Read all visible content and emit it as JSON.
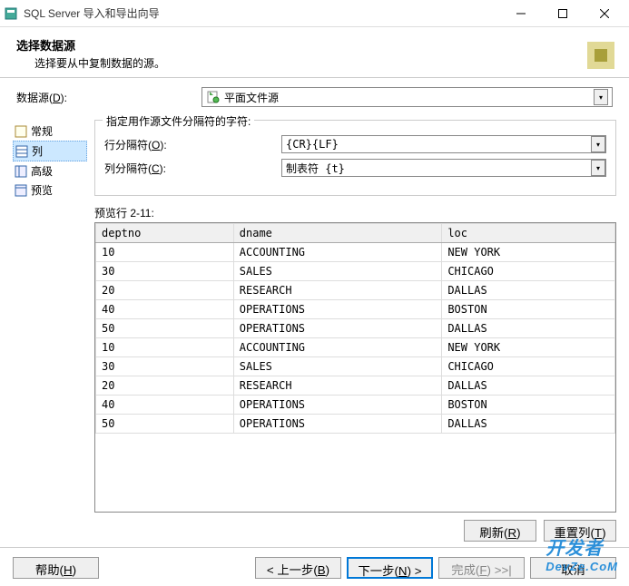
{
  "titlebar": {
    "text": "SQL Server 导入和导出向导"
  },
  "header": {
    "title": "选择数据源",
    "subtitle": "选择要从中复制数据的源。"
  },
  "datasource": {
    "label_pre": "数据源(",
    "label_key": "D",
    "label_post": "):",
    "value": "平面文件源"
  },
  "sidebar": {
    "items": [
      {
        "label": "常规"
      },
      {
        "label": "列"
      },
      {
        "label": "高级"
      },
      {
        "label": "预览"
      }
    ]
  },
  "delimiters": {
    "legend": "指定用作源文件分隔符的字符:",
    "row": {
      "label_pre": "行分隔符(",
      "label_key": "O",
      "label_post": "):",
      "value": "{CR}{LF}"
    },
    "col": {
      "label_pre": "列分隔符(",
      "label_key": "C",
      "label_post": "):",
      "value": "制表符 {t}"
    }
  },
  "preview": {
    "label": "预览行 2-11:",
    "columns": [
      "deptno",
      "dname",
      "loc"
    ],
    "rows": [
      [
        "10",
        "ACCOUNTING",
        "NEW YORK"
      ],
      [
        "30",
        "SALES",
        "CHICAGO"
      ],
      [
        "20",
        "RESEARCH",
        "DALLAS"
      ],
      [
        "40",
        "OPERATIONS",
        "BOSTON"
      ],
      [
        "50",
        "OPERATIONS",
        "DALLAS"
      ],
      [
        "10",
        "ACCOUNTING",
        "NEW YORK"
      ],
      [
        "30",
        "SALES",
        "CHICAGO"
      ],
      [
        "20",
        "RESEARCH",
        "DALLAS"
      ],
      [
        "40",
        "OPERATIONS",
        "BOSTON"
      ],
      [
        "50",
        "OPERATIONS",
        "DALLAS"
      ]
    ]
  },
  "buttons": {
    "refresh_pre": "刷新(",
    "refresh_key": "R",
    "refresh_post": ")",
    "reset_pre": "重置列(",
    "reset_key": "T",
    "reset_post": ")",
    "help_pre": "帮助(",
    "help_key": "H",
    "help_post": ")",
    "back_pre": "< 上一步(",
    "back_key": "B",
    "back_post": ")",
    "next_pre": "下一步(",
    "next_key": "N",
    "next_post": ") >",
    "finish_pre": "完成(",
    "finish_key": "F",
    "finish_post": ") >>|",
    "cancel": "取消"
  },
  "watermark": {
    "main": "开发者",
    "sub": "DevZe.CoM"
  }
}
